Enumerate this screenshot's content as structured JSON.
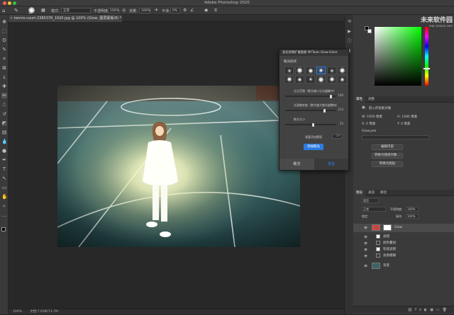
{
  "app": {
    "title": "Adobe Photoshop 2020"
  },
  "colors": {
    "accent": "#2b7be0",
    "window_close": "#ff5f57",
    "window_min": "#ffbd2e",
    "window_max": "#28c840",
    "foreground": "#000000",
    "background": "#ffffff"
  },
  "options_bar": {
    "mode_label": "模式:",
    "mode_value": "正常",
    "opacity_label": "不透明度:",
    "opacity_value": "100%",
    "flow_label": "流量:",
    "flow_value": "100%",
    "smooth_label": "平滑:",
    "smooth_value": "0%",
    "brush_size": "40"
  },
  "document": {
    "tab_title": "tennis-court-2385378_1920.jpg @ 100% (Glow, 图层蒙版/8) *"
  },
  "status": {
    "zoom": "100%",
    "doc_info": "文档:7.03M/71.7M"
  },
  "tools": [
    "move-icon",
    "marquee-icon",
    "lasso-icon",
    "quick-select-icon",
    "crop-icon",
    "frame-icon",
    "eyedropper-icon",
    "healing-icon",
    "brush-icon",
    "stamp-icon",
    "history-brush-icon",
    "eraser-icon",
    "gradient-icon",
    "blur-icon",
    "dodge-icon",
    "pen-icon",
    "type-icon",
    "path-select-icon",
    "rectangle-icon",
    "hand-icon",
    "zoom-icon",
    "more-icon"
  ],
  "dialog": {
    "title": "发光效果扩展面板 MFTools Glow-Glare",
    "section_title": "眩光形状",
    "sliders": [
      {
        "label": "泛光范围（数字越小泛光越集中）",
        "value": "100"
      },
      {
        "label": "光源散射度（数字越大散光越整体）",
        "value": "213"
      },
      {
        "label": "眩光大小",
        "value": "35"
      }
    ],
    "mask_label": "我要添加蒙版",
    "toggle_state": "OFF",
    "add_button": "添加眩光",
    "footer_tabs": [
      "眩光",
      "重置"
    ],
    "shape_grid_rows": 2,
    "shape_grid_cols": 6,
    "selected_shape": 3
  },
  "properties": {
    "tabs": [
      "属性",
      "调整"
    ],
    "layer_type": "嵌入的智能对象",
    "w_label": "W:",
    "w_value": "1920 像素",
    "h_label": "H:",
    "h_value": "1280 像素",
    "x_label": "X:",
    "x_value": "0 像素",
    "y_label": "Y:",
    "y_value": "0 像素",
    "filename": "Glow.psb",
    "buttons": [
      "编辑内容",
      "转换为链接对象...",
      "转换为图层"
    ]
  },
  "layers": {
    "tabs": [
      "图层",
      "通道",
      "路径"
    ],
    "filter_label": "类型",
    "blend_mode": "正常",
    "opacity_label": "不透明度:",
    "opacity_value": "100%",
    "lock_label": "锁定:",
    "fill_label": "填充:",
    "fill_value": "100%",
    "items": [
      {
        "name": "Glow",
        "kind": "smart"
      },
      {
        "name": "滤镜",
        "kind": "filter"
      },
      {
        "name": "颜色叠加",
        "kind": "sub"
      },
      {
        "name": "智能滤镜",
        "kind": "filter2"
      },
      {
        "name": "高斯模糊",
        "kind": "sub"
      },
      {
        "name": "背景",
        "kind": "bg"
      }
    ]
  },
  "watermark": {
    "text": "未来软件园",
    "sub": "mac.orsoon.com"
  }
}
